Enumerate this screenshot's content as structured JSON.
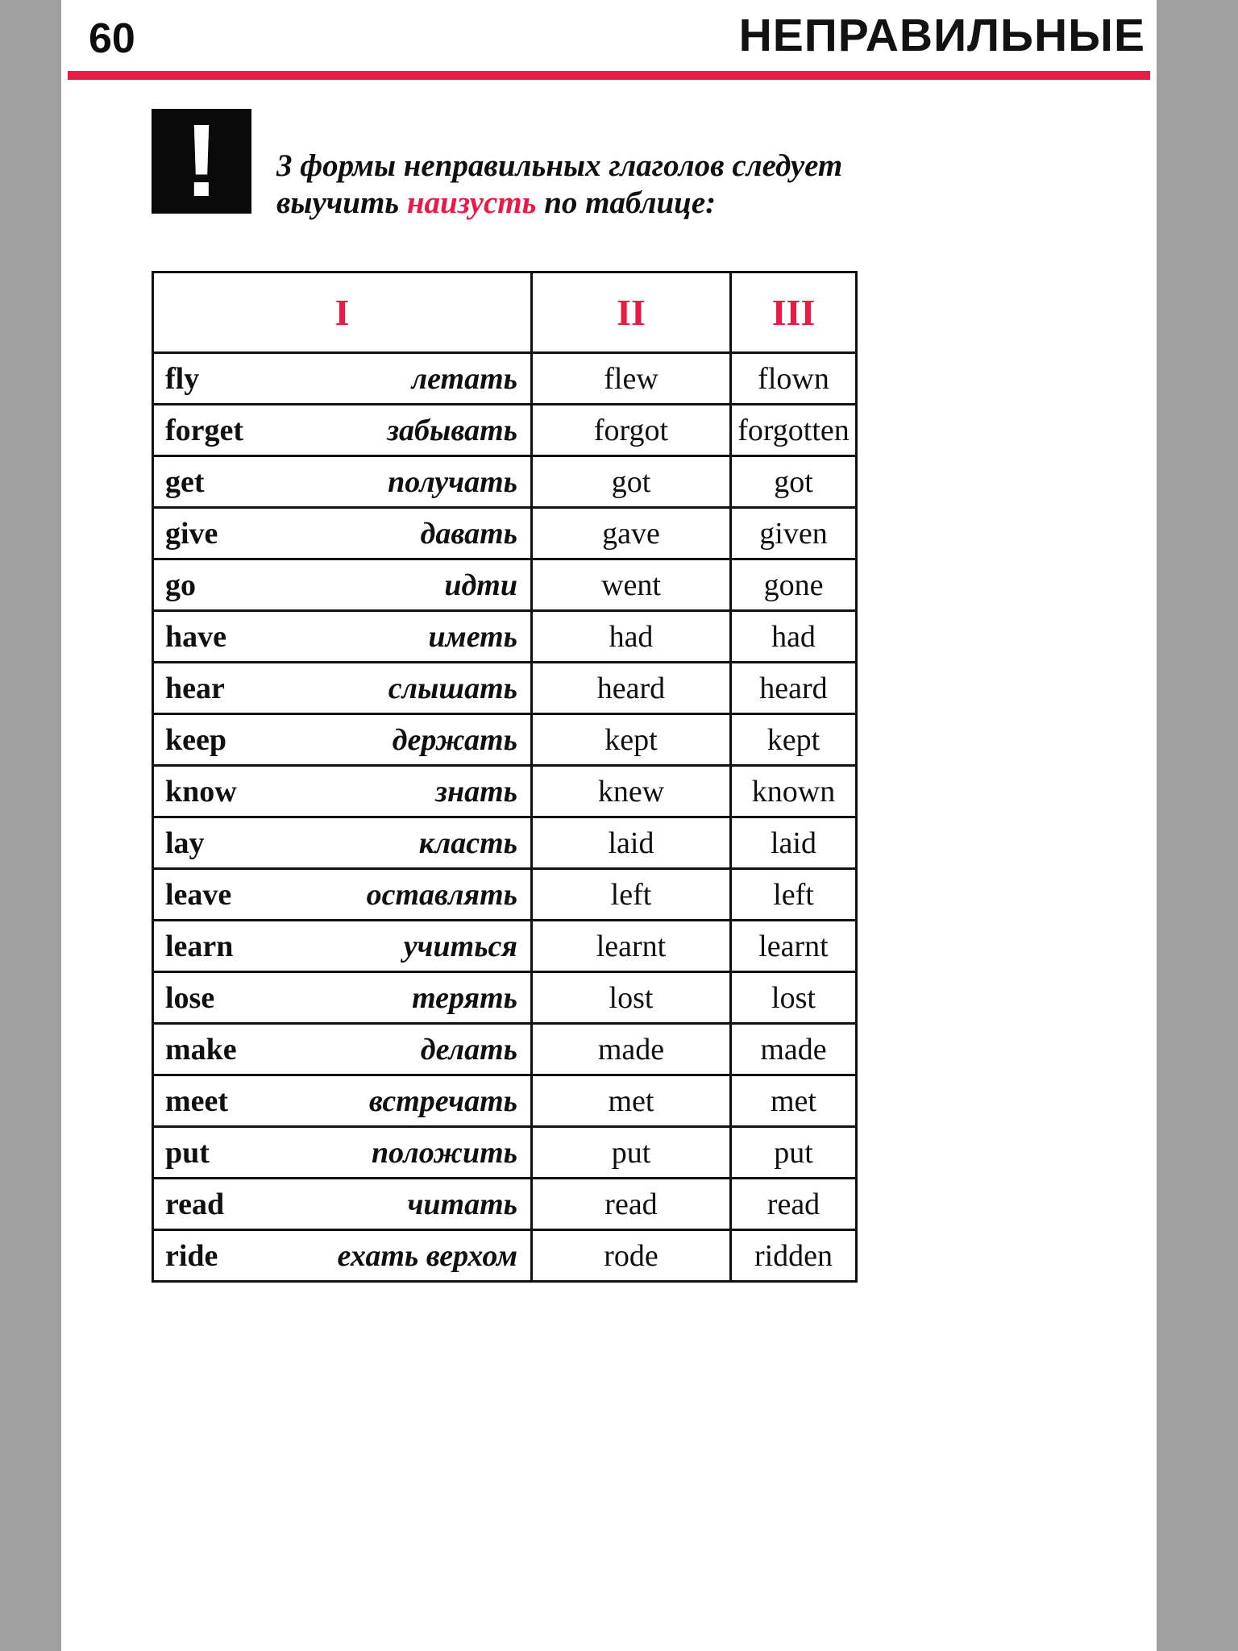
{
  "page": {
    "number": "60",
    "title": "НЕПРАВИЛЬНЫЕ",
    "accent_color": "#ec1846",
    "rule_color": "#ec1846",
    "text_color": "#101010"
  },
  "note": {
    "icon": "exclamation-mark",
    "icon_glyph": "!",
    "line1_before": "3 формы неправильных глаголов следует",
    "line2_before": "выучить ",
    "line2_accent": "наизусть",
    "line2_after": " по таблице:"
  },
  "table": {
    "headers": [
      "I",
      "II",
      "III"
    ],
    "rows": [
      {
        "infinitive": "fly",
        "translation": "летать",
        "past": "flew",
        "participle": "flown"
      },
      {
        "infinitive": "forget",
        "translation": "забывать",
        "past": "forgot",
        "participle": "forgotten"
      },
      {
        "infinitive": "get",
        "translation": "получать",
        "past": "got",
        "participle": "got"
      },
      {
        "infinitive": "give",
        "translation": "давать",
        "past": "gave",
        "participle": "given"
      },
      {
        "infinitive": "go",
        "translation": "идти",
        "past": "went",
        "participle": "gone"
      },
      {
        "infinitive": "have",
        "translation": "иметь",
        "past": "had",
        "participle": "had"
      },
      {
        "infinitive": "hear",
        "translation": "слышать",
        "past": "heard",
        "participle": "heard"
      },
      {
        "infinitive": "keep",
        "translation": "держать",
        "past": "kept",
        "participle": "kept"
      },
      {
        "infinitive": "know",
        "translation": "знать",
        "past": "knew",
        "participle": "known"
      },
      {
        "infinitive": "lay",
        "translation": "класть",
        "past": "laid",
        "participle": "laid"
      },
      {
        "infinitive": "leave",
        "translation": "оставлять",
        "past": "left",
        "participle": "left"
      },
      {
        "infinitive": "learn",
        "translation": "учиться",
        "past": "learnt",
        "participle": "learnt"
      },
      {
        "infinitive": "lose",
        "translation": "терять",
        "past": "lost",
        "participle": "lost"
      },
      {
        "infinitive": "make",
        "translation": "делать",
        "past": "made",
        "participle": "made"
      },
      {
        "infinitive": "meet",
        "translation": "встречать",
        "past": "met",
        "participle": "met"
      },
      {
        "infinitive": "put",
        "translation": "положить",
        "past": "put",
        "participle": "put"
      },
      {
        "infinitive": "read",
        "translation": "читать",
        "past": "read",
        "participle": "read"
      },
      {
        "infinitive": "ride",
        "translation": "ехать верхом",
        "past": "rode",
        "participle": "ridden"
      }
    ]
  }
}
